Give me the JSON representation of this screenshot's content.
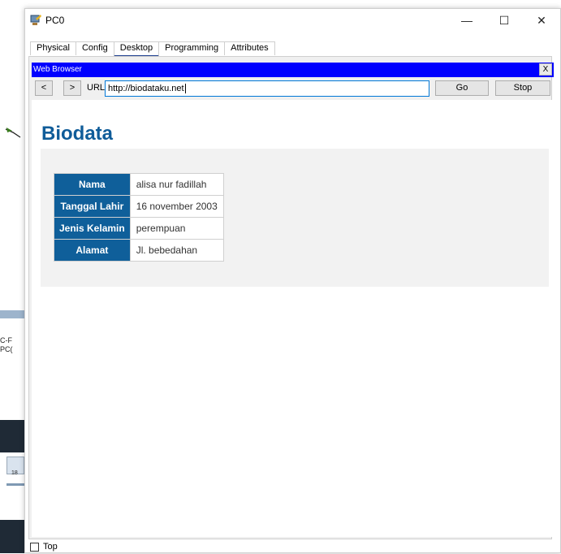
{
  "background": {
    "labels": [
      "C-F",
      "PC("
    ],
    "icon_caption": "18"
  },
  "window": {
    "title": "PC0",
    "controls": {
      "minimize": "—",
      "maximize": "☐",
      "close": "✕"
    }
  },
  "tabs": [
    {
      "label": "Physical",
      "active": false
    },
    {
      "label": "Config",
      "active": false
    },
    {
      "label": "Desktop",
      "active": true
    },
    {
      "label": "Programming",
      "active": false
    },
    {
      "label": "Attributes",
      "active": false
    }
  ],
  "web_browser": {
    "title": "Web Browser",
    "close_label": "X",
    "back_label": "<",
    "forward_label": ">",
    "url_label": "URL",
    "url_value": "http://biodataku.net",
    "go_label": "Go",
    "stop_label": "Stop"
  },
  "page": {
    "title": "Biodata",
    "rows": [
      {
        "label": "Nama",
        "value": "alisa nur fadillah"
      },
      {
        "label": "Tanggal Lahir",
        "value": "16 november 2003"
      },
      {
        "label": "Jenis Kelamin",
        "value": "perempuan"
      },
      {
        "label": "Alamat",
        "value": "Jl. bebedahan"
      }
    ]
  },
  "footer": {
    "top_label": "Top",
    "top_checked": false
  },
  "colors": {
    "browser_title_bar": "#0000ff",
    "heading": "#0f5c99",
    "table_header": "#0f5f9a",
    "active_tab_underline": "#1c3e8f"
  }
}
